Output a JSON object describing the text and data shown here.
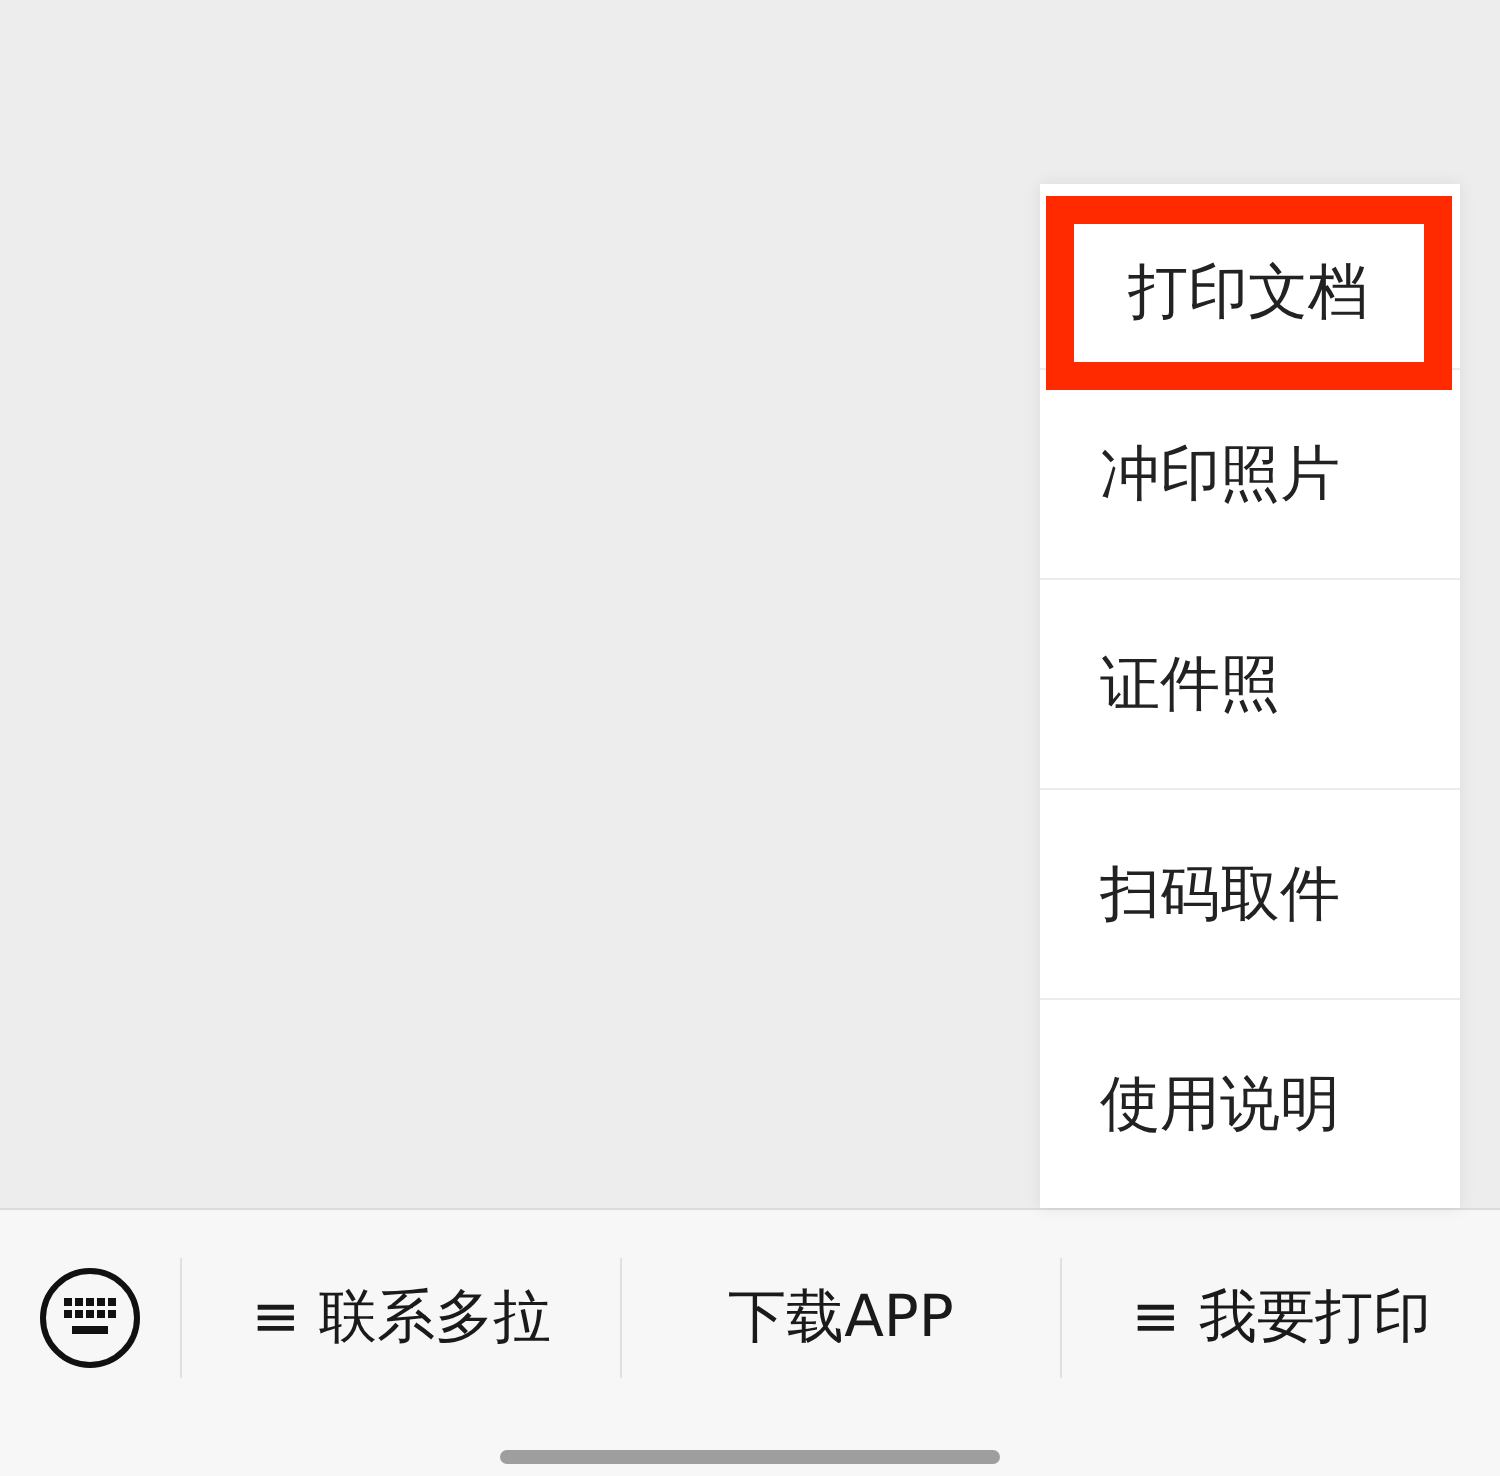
{
  "popup_menu": {
    "items": [
      {
        "label": "打印文档",
        "highlighted": true
      },
      {
        "label": "冲印照片",
        "highlighted": false
      },
      {
        "label": "证件照",
        "highlighted": false
      },
      {
        "label": "扫码取件",
        "highlighted": false
      },
      {
        "label": "使用说明",
        "highlighted": false
      }
    ]
  },
  "bottom_menu": {
    "items": [
      {
        "label": "≡ 联系多拉"
      },
      {
        "label": "下载APP"
      },
      {
        "label": "≡ 我要打印"
      }
    ]
  }
}
